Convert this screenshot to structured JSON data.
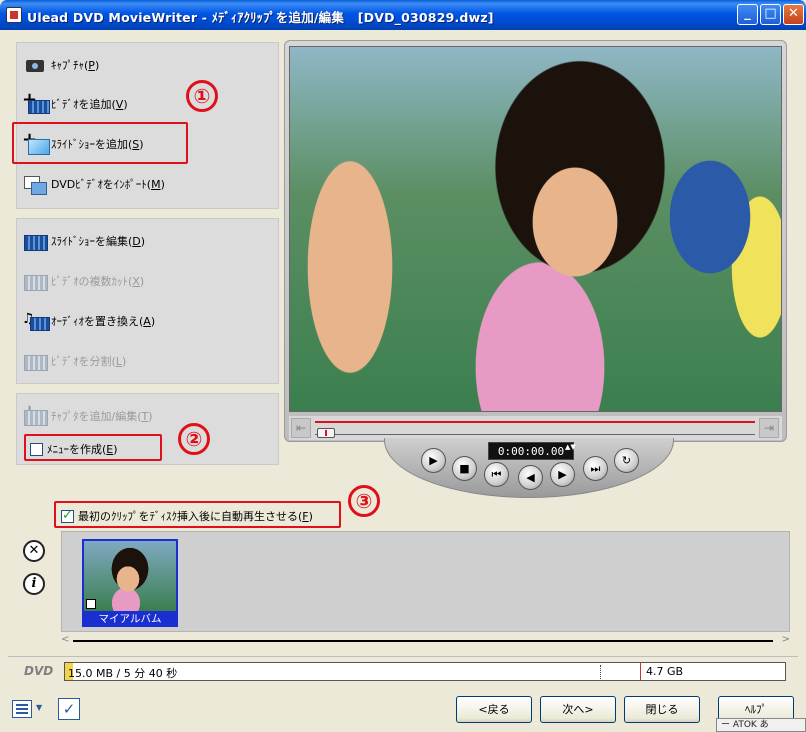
{
  "window": {
    "title": "Ulead DVD MovieWriter - ﾒﾃﾞｨｱｸﾘｯﾌﾟを追加/編集   [DVD_030829.dwz]",
    "min_label": "_",
    "max_label": "□",
    "close_label": "✕"
  },
  "panel1": {
    "capture": {
      "label": "ｷｬﾌﾟﾁｬ(",
      "key": "P",
      "end": ")"
    },
    "add_video": {
      "label": "ﾋﾞﾃﾞｵを追加(",
      "key": "V",
      "end": ")"
    },
    "add_slideshow": {
      "label": "ｽﾗｲﾄﾞｼｮｰを追加(",
      "key": "S",
      "end": ")"
    },
    "import_dvd": {
      "label": "DVDﾋﾞﾃﾞｵをｲﾝﾎﾟｰﾄ(",
      "key": "M",
      "end": ")"
    }
  },
  "panel2": {
    "edit_slideshow": {
      "label": "ｽﾗｲﾄﾞｼｮｰを編集(",
      "key": "D",
      "end": ")"
    },
    "multi_trim": {
      "label": "ﾋﾞﾃﾞｵの複数ｶｯﾄ(",
      "key": "X",
      "end": ")"
    },
    "replace_audio": {
      "label": "ｵｰﾃﾞｨｵを置き換え(",
      "key": "A",
      "end": ")"
    },
    "split_video": {
      "label": "ﾋﾞﾃﾞｵを分割(",
      "key": "L",
      "end": ")"
    }
  },
  "panel3": {
    "add_chapter": {
      "label": "ﾁｬﾌﾟﾀを追加/編集(",
      "key": "T",
      "end": ")"
    },
    "create_menu": {
      "label": "ﾒﾆｭｰを作成(",
      "key": "E",
      "end": ")",
      "checked": false
    }
  },
  "annotations": {
    "n1": "①",
    "n2": "②",
    "n3": "③",
    "color": "#e0101a"
  },
  "player": {
    "timecode": "0:00:00.00",
    "spin": "▲▼",
    "scrub_prev": "⇤",
    "scrub_next": "⇥",
    "buttons": {
      "play": "▶",
      "stop": "■",
      "start": "⏮",
      "prev_frame": "◀",
      "next_frame": "▶",
      "end": "⏭",
      "repeat": "↻"
    }
  },
  "autoplay": {
    "label": "最初のｸﾘｯﾌﾟをﾃﾞｨｽｸ挿入後に自動再生させる(",
    "key": "F",
    "end": ")",
    "checked": true
  },
  "media": {
    "delete_icon": "✕",
    "info_icon": "i",
    "clips": [
      {
        "name": "マイアルバム"
      }
    ],
    "scroll_left": "<",
    "scroll_right": ">"
  },
  "dvd": {
    "label": "DVD",
    "used_text": "15.0 MB / 5 分 40 秒",
    "capacity": "4.7 GB",
    "used_fraction": 0.003
  },
  "footer": {
    "back": "<戻る",
    "next": "次へ>",
    "close": "閉じる",
    "help": "ﾍﾙﾌﾟ"
  },
  "ime": {
    "text": "ー ATOK あ"
  }
}
